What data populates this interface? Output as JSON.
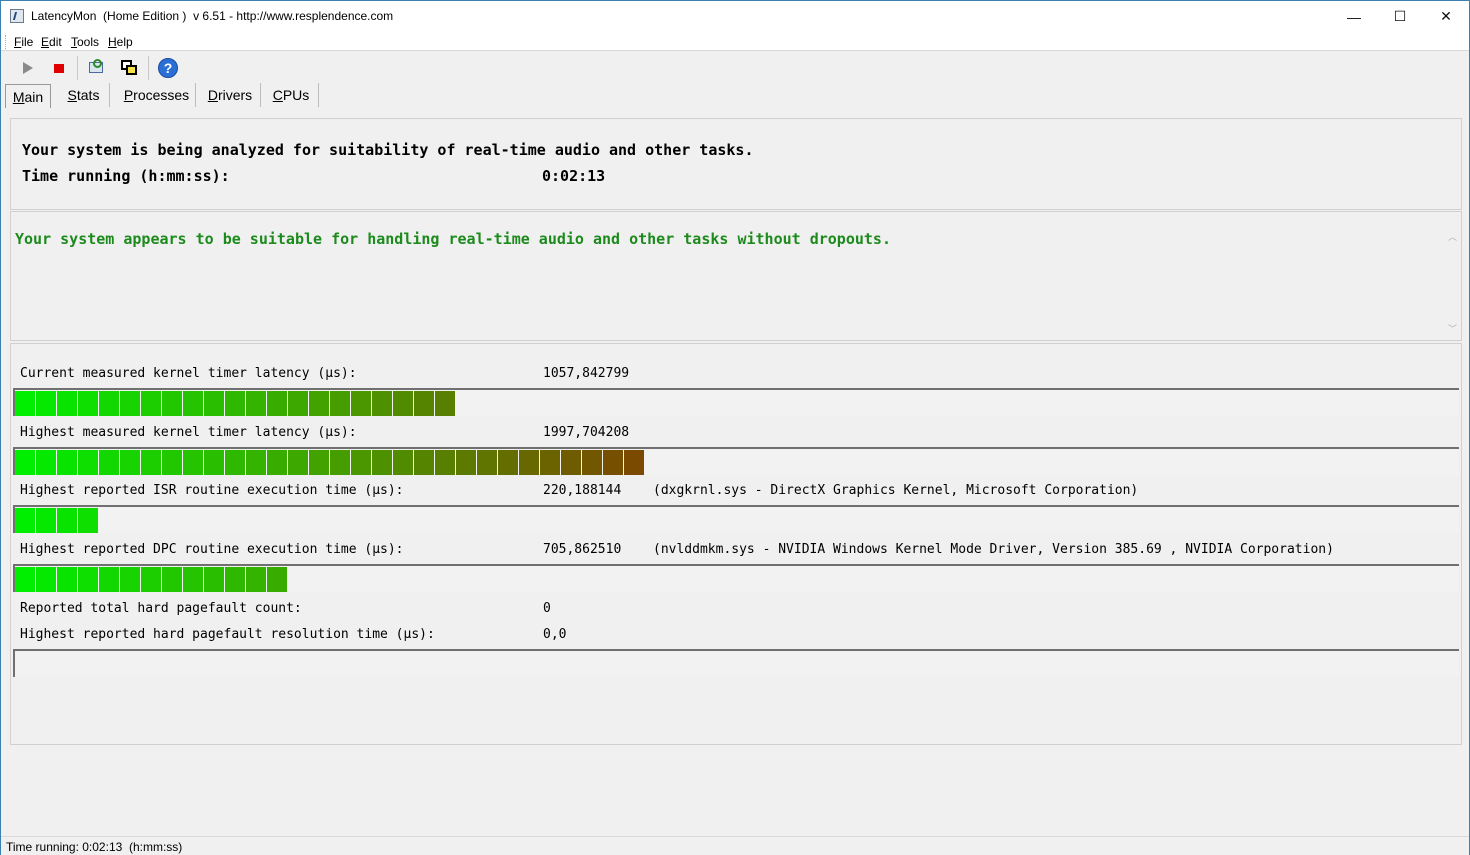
{
  "window": {
    "title": "LatencyMon  (Home Edition )  v 6.51 - http://www.resplendence.com",
    "minimize_glyph": "—",
    "maximize_glyph": "☐",
    "close_glyph": "✕"
  },
  "menu": [
    {
      "label": "File",
      "accel": "F",
      "rest": "ile"
    },
    {
      "label": "Edit",
      "accel": "E",
      "rest": "dit"
    },
    {
      "label": "Tools",
      "accel": "T",
      "rest": "ools"
    },
    {
      "label": "Help",
      "accel": "H",
      "rest": "elp"
    }
  ],
  "toolbar": {
    "icons": [
      "play-icon",
      "stop-icon",
      "scan-icon",
      "window-icon",
      "help-icon"
    ],
    "help_glyph": "?"
  },
  "tabs": [
    {
      "label": "Main",
      "accel": "M",
      "rest": "ain",
      "active": true
    },
    {
      "label": "Stats",
      "accel": "S",
      "rest": "tats",
      "active": false
    },
    {
      "label": "Processes",
      "accel": "P",
      "rest": "rocesses",
      "active": false
    },
    {
      "label": "Drivers",
      "accel": "D",
      "rest": "rivers",
      "active": false
    },
    {
      "label": "CPUs",
      "accel": "C",
      "rest": "PUs",
      "active": false
    }
  ],
  "analysis": {
    "line1": "Your system is being analyzed for suitability of real-time audio and other tasks.",
    "time_label": "Time running (h:mm:ss):",
    "time_value": "0:02:13"
  },
  "verdict": {
    "message": "Your system appears to be suitable for handling real-time audio and other tasks without dropouts.",
    "color": "#1c8a1c"
  },
  "metrics": {
    "current_kernel": {
      "label": "Current measured kernel timer latency (µs):",
      "value": "1057,842799",
      "bar_segments": 21
    },
    "highest_kernel": {
      "label": "Highest measured kernel timer latency (µs):",
      "value": "1997,704208",
      "bar_segments": 30
    },
    "isr": {
      "label": "Highest reported ISR routine execution time (µs):",
      "value": "220,188144",
      "extra": "(dxgkrnl.sys - DirectX Graphics Kernel, Microsoft Corporation)",
      "bar_segments": 4
    },
    "dpc": {
      "label": "Highest reported DPC routine execution time (µs):",
      "value": "705,862510",
      "extra": "(nvlddmkm.sys - NVIDIA Windows Kernel Mode Driver, Version 385.69 , NVIDIA Corporation)",
      "bar_segments": 13
    },
    "pagefault_count": {
      "label": "Reported total hard pagefault count:",
      "value": "0"
    },
    "pagefault_time": {
      "label": "Highest reported hard pagefault resolution time (µs):",
      "value": "0,0",
      "bar_segments": 0
    }
  },
  "bar_colors": {
    "start": "#00ee00",
    "mid": "#44a000",
    "end": "#7a4a00"
  },
  "status": {
    "text": "Time running: 0:02:13  (h:mm:ss)"
  }
}
